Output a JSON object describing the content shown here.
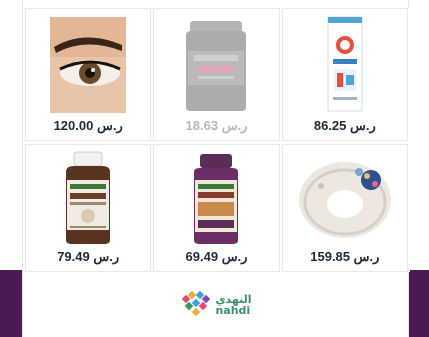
{
  "products": [
    {
      "price": "86.25",
      "currency": "ر.س",
      "image": "apivit-product-box",
      "dim": false
    },
    {
      "price": "18.63",
      "currency": "ر.س",
      "image": "maca-supplement-jar",
      "dim": true
    },
    {
      "price": "120.00",
      "currency": "ر.س",
      "image": "eyelash-eye-closeup",
      "dim": false
    },
    {
      "price": "159.85",
      "currency": "ر.س",
      "image": "nursing-pillow",
      "dim": false
    },
    {
      "price": "69.49",
      "currency": "ر.س",
      "image": "cinnamon-supplement-bottle",
      "dim": false
    },
    {
      "price": "79.49",
      "currency": "ر.س",
      "image": "coconut-oil-bottle",
      "dim": false
    }
  ],
  "brand": {
    "name_ar": "النهدي",
    "name_en": "nahdi"
  },
  "colors": {
    "side_bars": "#4b1a55",
    "price_text": "#1e2a39",
    "logo_green": "#3b8f66"
  }
}
